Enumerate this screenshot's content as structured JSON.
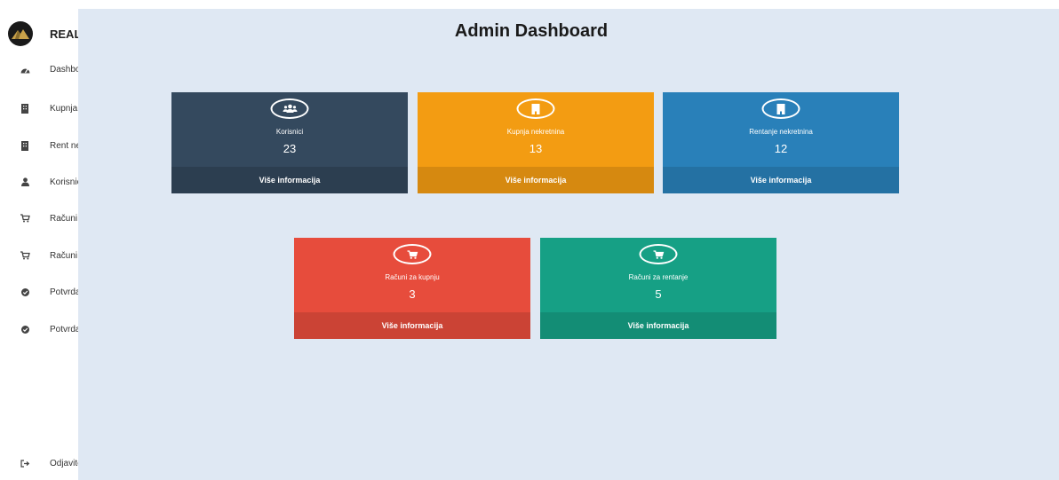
{
  "sidebar": {
    "brand": "REAL",
    "items": [
      {
        "label": "Dashbo",
        "icon": "dashboard-icon"
      },
      {
        "label": "Kupnja",
        "icon": "building-icon"
      },
      {
        "label": "Rent ne",
        "icon": "building-icon"
      },
      {
        "label": "Korisnic",
        "icon": "user-icon"
      },
      {
        "label": "Računi",
        "icon": "cart-icon"
      },
      {
        "label": "Računi",
        "icon": "cart-icon"
      },
      {
        "label": "Potvrda",
        "icon": "check-circle-icon"
      },
      {
        "label": "Potvrda",
        "icon": "check-circle-icon"
      }
    ],
    "logout": {
      "label": "Odjavite",
      "icon": "sign-out-icon"
    }
  },
  "main": {
    "title": "Admin Dashboard",
    "cards": [
      {
        "label": "Korisnici",
        "value": "23",
        "footer": "Više informacija",
        "icon": "users-icon",
        "color": "#34495e",
        "footer_color": "#2c3e50"
      },
      {
        "label": "Kupnja nekretnina",
        "value": "13",
        "footer": "Više informacija",
        "icon": "building-icon",
        "color": "#f39c12",
        "footer_color": "#d68910"
      },
      {
        "label": "Rentanje nekretnina",
        "value": "12",
        "footer": "Više informacija",
        "icon": "building-icon",
        "color": "#2980b9",
        "footer_color": "#2471a3"
      },
      {
        "label": "Računi za kupnju",
        "value": "3",
        "footer": "Više informacija",
        "icon": "cart-icon",
        "color": "#e74c3c",
        "footer_color": "#cb4335"
      },
      {
        "label": "Računi za rentanje",
        "value": "5",
        "footer": "Više informacija",
        "icon": "cart-icon",
        "color": "#16a085",
        "footer_color": "#138d75"
      }
    ]
  }
}
